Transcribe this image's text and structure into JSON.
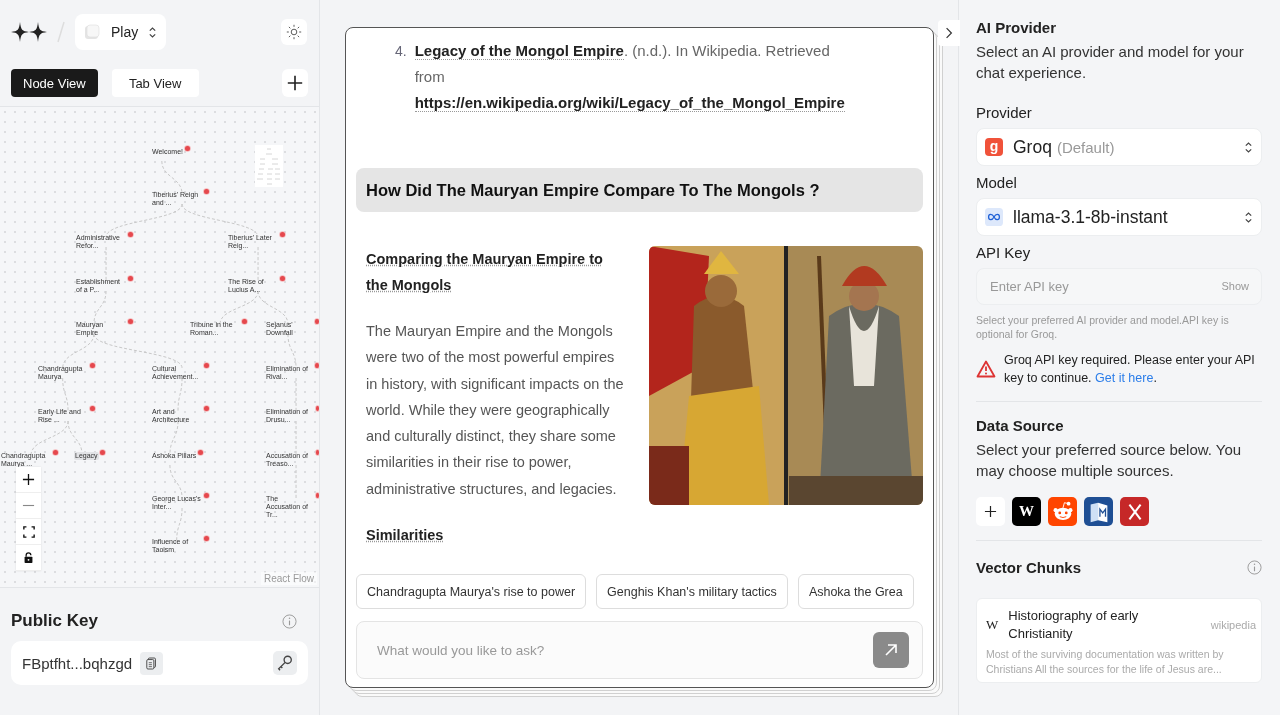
{
  "header": {
    "project": "Play"
  },
  "view_tabs": [
    {
      "label": "Node View",
      "selected": true
    },
    {
      "label": "Tab View",
      "selected": false
    }
  ],
  "graph": {
    "nodes": [
      {
        "label": "Welcome!",
        "selected": false,
        "children": [
          {
            "label": "Tiberius' Reign and ...",
            "selected": false,
            "children": [
              {
                "label": "Administrative Refor...",
                "selected": false,
                "children": [
                  {
                    "label": "Establishment of a P...",
                    "selected": false,
                    "children": [
                      {
                        "label": "Mauryan Empire",
                        "selected": false,
                        "children": [
                          {
                            "label": "Chandragupta Maurya",
                            "selected": false,
                            "children": [
                              {
                                "label": "Early Life and Rise ...",
                                "selected": false,
                                "children": [
                                  {
                                    "label": "Chandragupta Maurya ...",
                                    "selected": false
                                  },
                                  {
                                    "label": "Legacy",
                                    "selected": true
                                  }
                                ]
                              }
                            ]
                          },
                          {
                            "label": "Cultural Achievement...",
                            "selected": false,
                            "children": [
                              {
                                "label": "Art and Architecture",
                                "selected": false,
                                "children": [
                                  {
                                    "label": "Ashoka Pillars",
                                    "selected": false,
                                    "children": [
                                      {
                                        "label": "George Lucas's Inter...",
                                        "selected": false,
                                        "children": [
                                          {
                                            "label": "Influence of Taoism",
                                            "selected": false
                                          }
                                        ]
                                      }
                                    ]
                                  }
                                ]
                              }
                            ]
                          }
                        ]
                      }
                    ]
                  }
                ]
              },
              {
                "label": "Tiberius' Later Reig...",
                "selected": false,
                "children": [
                  {
                    "label": "The Rise of Lucius A...",
                    "selected": false,
                    "children": [
                      {
                        "label": "Tribune in the Roman...",
                        "selected": false
                      },
                      {
                        "label": "Sejanus' Downfall",
                        "selected": false,
                        "children": [
                          {
                            "label": "Elimination of Rival...",
                            "selected": false,
                            "children": [
                              {
                                "label": "Elimination of Drusu...",
                                "selected": false,
                                "children": [
                                  {
                                    "label": "Accusation of Treaso...",
                                    "selected": false,
                                    "children": [
                                      {
                                        "label": "The Accusation of Tr...",
                                        "selected": false
                                      }
                                    ]
                                  }
                                ]
                              }
                            ]
                          }
                        ]
                      }
                    ]
                  }
                ]
              }
            ]
          }
        ]
      }
    ],
    "attribution": "React Flow"
  },
  "public_key": {
    "title": "Public Key",
    "value": "FBptfht...bqhzgd"
  },
  "chat": {
    "reference": {
      "number": "4.",
      "title": "Legacy of the Mongol Empire",
      "text": ". (n.d.). In Wikipedia. Retrieved from",
      "url": "https://en.wikipedia.org/wiki/Legacy_of_the_Mongol_Empire"
    },
    "question": "How Did The Mauryan Empire Compare To The Mongols ?",
    "answer_heading": "Comparing the Mauryan Empire to the Mongols",
    "answer_text": "The Mauryan Empire and the Mongols were two of the most powerful empires in history, with significant impacts on the world. While they were geographically and culturally distinct, they share some similarities in their rise to power, administrative structures, and legacies.",
    "subheading": "Similarities",
    "suggestions": [
      "Chandragupta Maurya's rise to power",
      "Genghis Khan's military tactics",
      "Ashoka the Grea"
    ],
    "input": {
      "placeholder": "What would you like to ask?"
    }
  },
  "settings": {
    "ai_provider": {
      "title": "AI Provider",
      "description": "Select an AI provider and model for your chat experience."
    },
    "provider": {
      "label": "Provider",
      "icon_glyph": "g",
      "value": "Groq",
      "note": "(Default)"
    },
    "model": {
      "label": "Model",
      "value": "llama-3.1-8b-instant"
    },
    "api_key": {
      "label": "API Key",
      "placeholder": "Enter API key",
      "toggle": "Show",
      "hint": "Select your preferred AI provider and model.API key is optional for Groq."
    },
    "warning": {
      "text": "Groq API key required. Please enter your API key to continue.",
      "link": "Get it here",
      "end": "."
    },
    "data_source": {
      "title": "Data Source",
      "description": "Select your preferred source below. You may choose multiple sources.",
      "sources": [
        {
          "kind": "wikipedia",
          "glyph": "W"
        },
        {
          "kind": "reddit"
        },
        {
          "kind": "book"
        },
        {
          "kind": "x"
        }
      ]
    },
    "vector_chunks": {
      "title": "Vector Chunks",
      "chunks": [
        {
          "source_glyph": "W",
          "title": "Historiography of early Christianity",
          "source": "wikipedia",
          "excerpt": "Most of the surviving documentation was written by Christians All the sources for the life of Jesus are..."
        }
      ]
    }
  }
}
